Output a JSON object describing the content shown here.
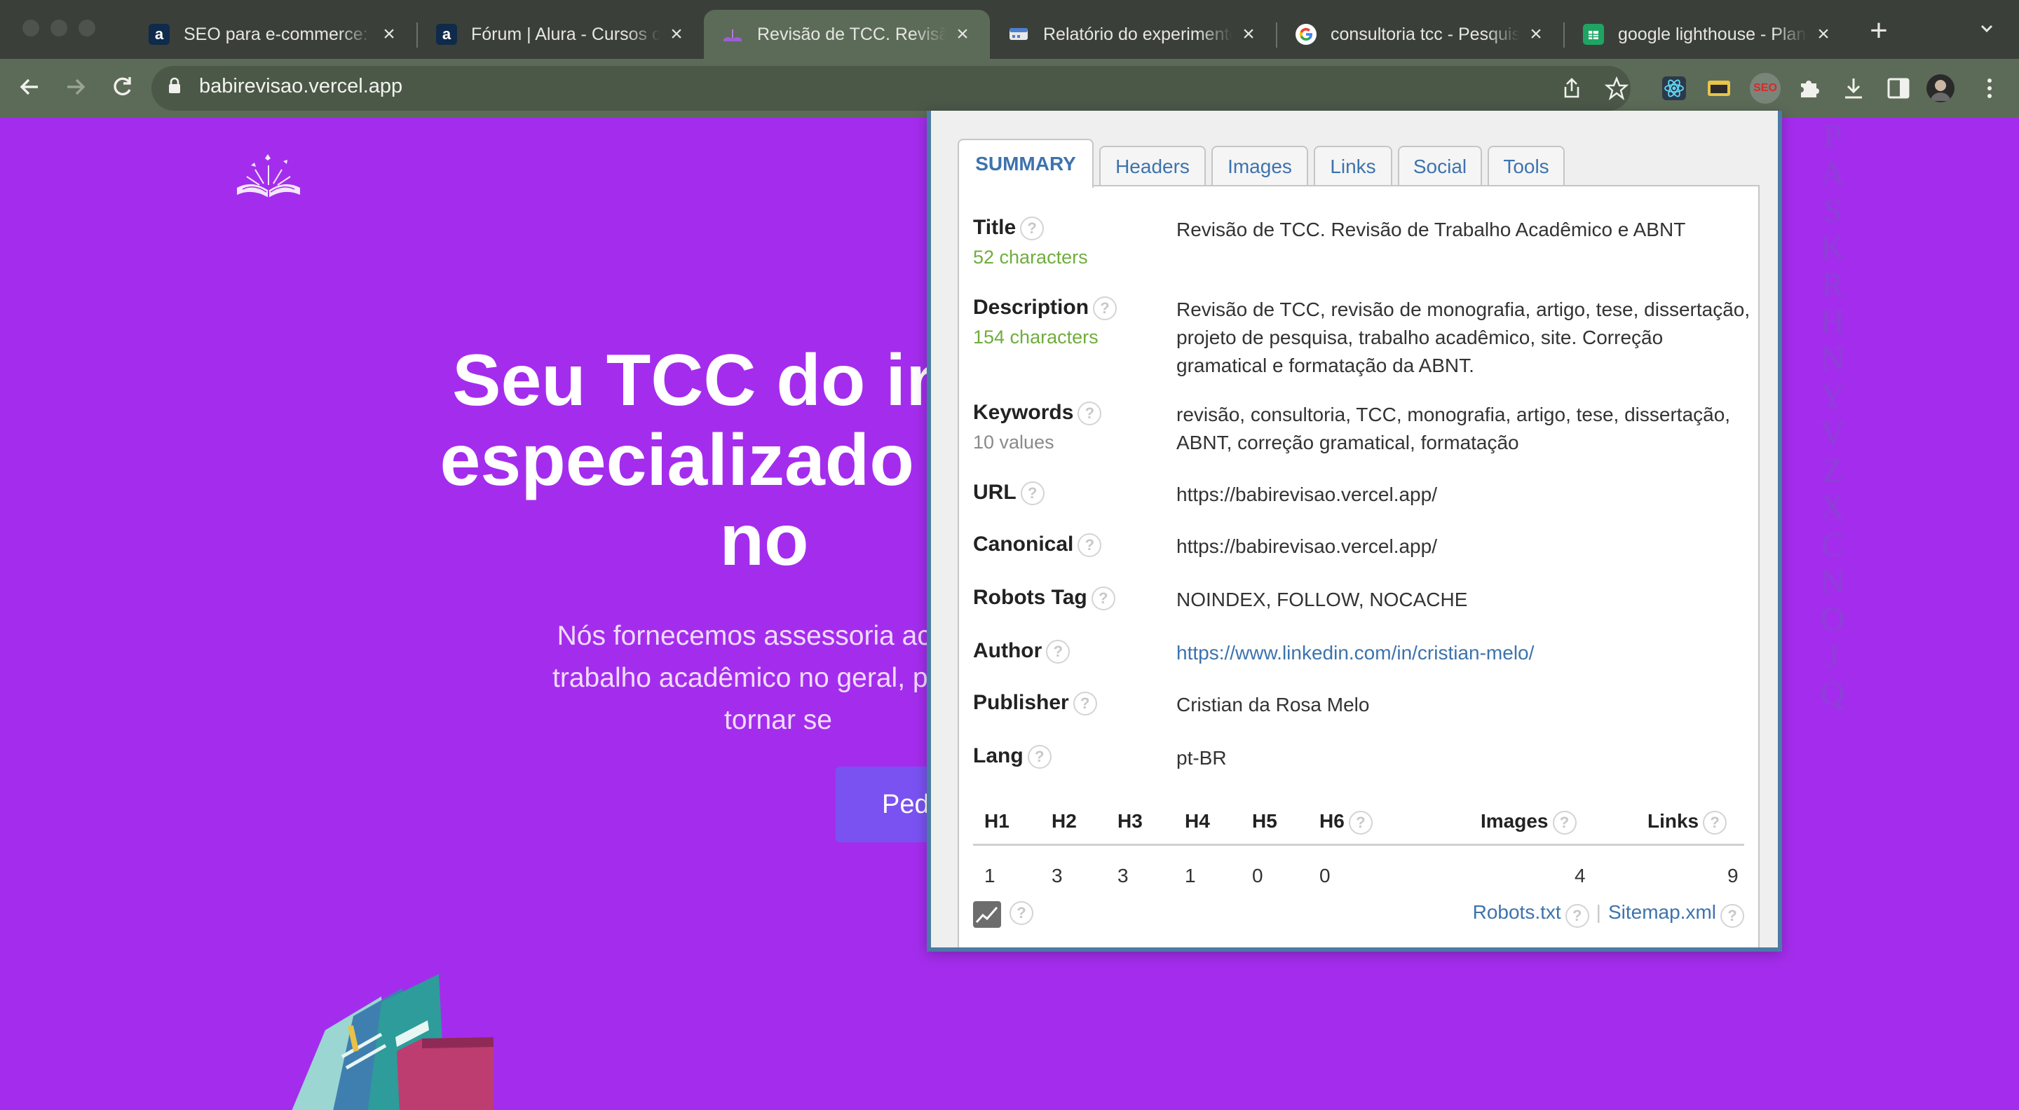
{
  "browser": {
    "tabs": [
      {
        "title": "SEO para e-commerce: e",
        "favicon": "a",
        "favicon_bg": "#0f2a4a",
        "active": false
      },
      {
        "title": "Fórum | Alura - Cursos o",
        "favicon": "a",
        "favicon_bg": "#0f2a4a",
        "active": false
      },
      {
        "title": "Revisão de TCC. Revisão",
        "favicon": "book-icon",
        "active": true
      },
      {
        "title": "Relatório do experimento",
        "favicon": "report-icon",
        "active": false
      },
      {
        "title": "consultoria tcc - Pesquis",
        "favicon": "google-icon",
        "active": false
      },
      {
        "title": "google lighthouse - Plan",
        "favicon": "sheets-icon",
        "active": false
      }
    ],
    "address": "babirevisao.vercel.app",
    "extension_badge": "SEO"
  },
  "page": {
    "hero_title_lines": [
      "Seu TCC do início",
      "especializado para",
      "no"
    ],
    "hero_sub_lines": [
      "Nós fornecemos assessoria acadêm",
      "trabalho acadêmico no geral, para es",
      "tornar se"
    ],
    "cta_label": "Ped",
    "side_letters": [
      "P",
      "A",
      "S",
      "K",
      "R",
      "H",
      "N",
      "Y",
      "V",
      "Z",
      "X",
      "C",
      "N",
      "O",
      "J",
      "Q"
    ]
  },
  "seo_popup": {
    "tabs": [
      "SUMMARY",
      "Headers",
      "Images",
      "Links",
      "Social",
      "Tools"
    ],
    "rows": {
      "title": {
        "label": "Title",
        "sub": "52 characters",
        "value": "Revisão de TCC. Revisão de Trabalho Acadêmico e ABNT"
      },
      "description": {
        "label": "Description",
        "sub": "154 characters",
        "value": "Revisão de TCC, revisão de monografia, artigo, tese, dissertação, projeto de pesquisa, trabalho acadêmico, site. Correção gramatical e formatação da ABNT."
      },
      "keywords": {
        "label": "Keywords",
        "sub": "10 values",
        "value": "revisão, consultoria, TCC, monografia, artigo, tese, dissertação, ABNT, correção gramatical, formatação"
      },
      "url": {
        "label": "URL",
        "value": "https://babirevisao.vercel.app/"
      },
      "canonical": {
        "label": "Canonical",
        "value": "https://babirevisao.vercel.app/"
      },
      "robots": {
        "label": "Robots Tag",
        "value": "NOINDEX, FOLLOW, NOCACHE"
      },
      "author": {
        "label": "Author",
        "value": "https://www.linkedin.com/in/cristian-melo/"
      },
      "publisher": {
        "label": "Publisher",
        "value": "Cristian da Rosa Melo"
      },
      "lang": {
        "label": "Lang",
        "value": "pt-BR"
      }
    },
    "stats": {
      "headers": [
        "H1",
        "H2",
        "H3",
        "H4",
        "H5",
        "H6",
        "Images",
        "Links"
      ],
      "values": [
        "1",
        "3",
        "3",
        "1",
        "0",
        "0",
        "4",
        "9"
      ]
    },
    "footer": {
      "robots_link": "Robots.txt",
      "sitemap_link": "Sitemap.xml"
    },
    "help_glyph": "?"
  },
  "colors": {
    "page_bg": "#a42ded",
    "popup_border": "#4b7ba6",
    "link": "#3d73ad",
    "green_sub": "#6fad3c",
    "cta": "#7a52f2"
  }
}
